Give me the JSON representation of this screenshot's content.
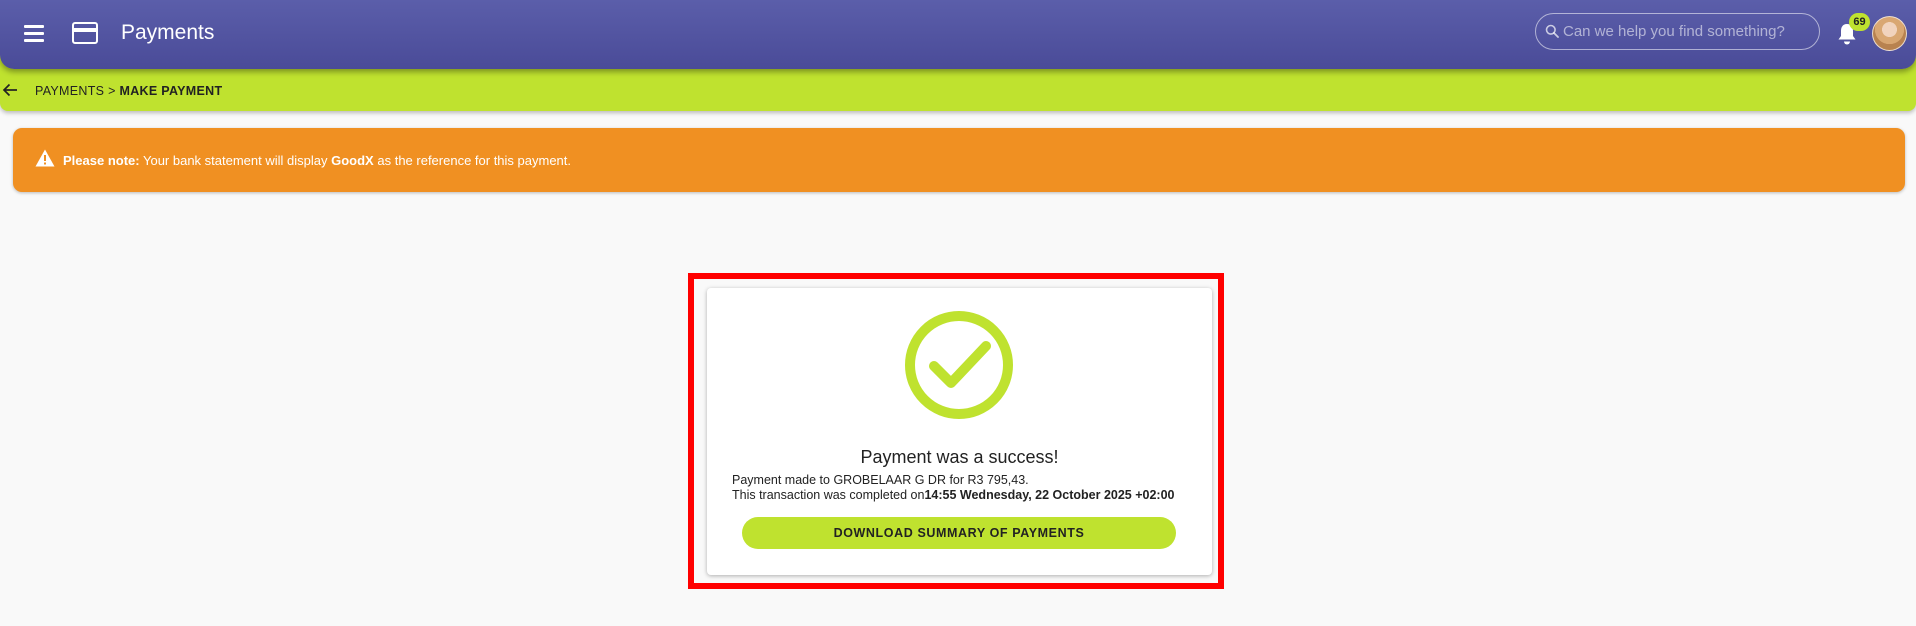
{
  "header": {
    "title": "Payments",
    "search_placeholder": "Can we help you find something?",
    "notification_count": "69",
    "accent": "#bfe22f",
    "bar_color": "#5053a0"
  },
  "breadcrumb": {
    "parent": "PAYMENTS",
    "separator": ">",
    "current": "MAKE PAYMENT"
  },
  "alert": {
    "label": "Please note:",
    "text_before": "Your bank statement will display",
    "brand": "GoodX",
    "text_after": "as the reference for this payment.",
    "color": "#f09022"
  },
  "result": {
    "title": "Payment was a success!",
    "line1": "Payment made to GROBELAAR G DR for R3 795,43.",
    "line2_prefix": "This transaction was completed on",
    "timestamp": "14:55 Wednesday, 22 October 2025 +02:00",
    "button_label": "DOWNLOAD SUMMARY OF PAYMENTS",
    "icon": "check-circle-icon"
  }
}
